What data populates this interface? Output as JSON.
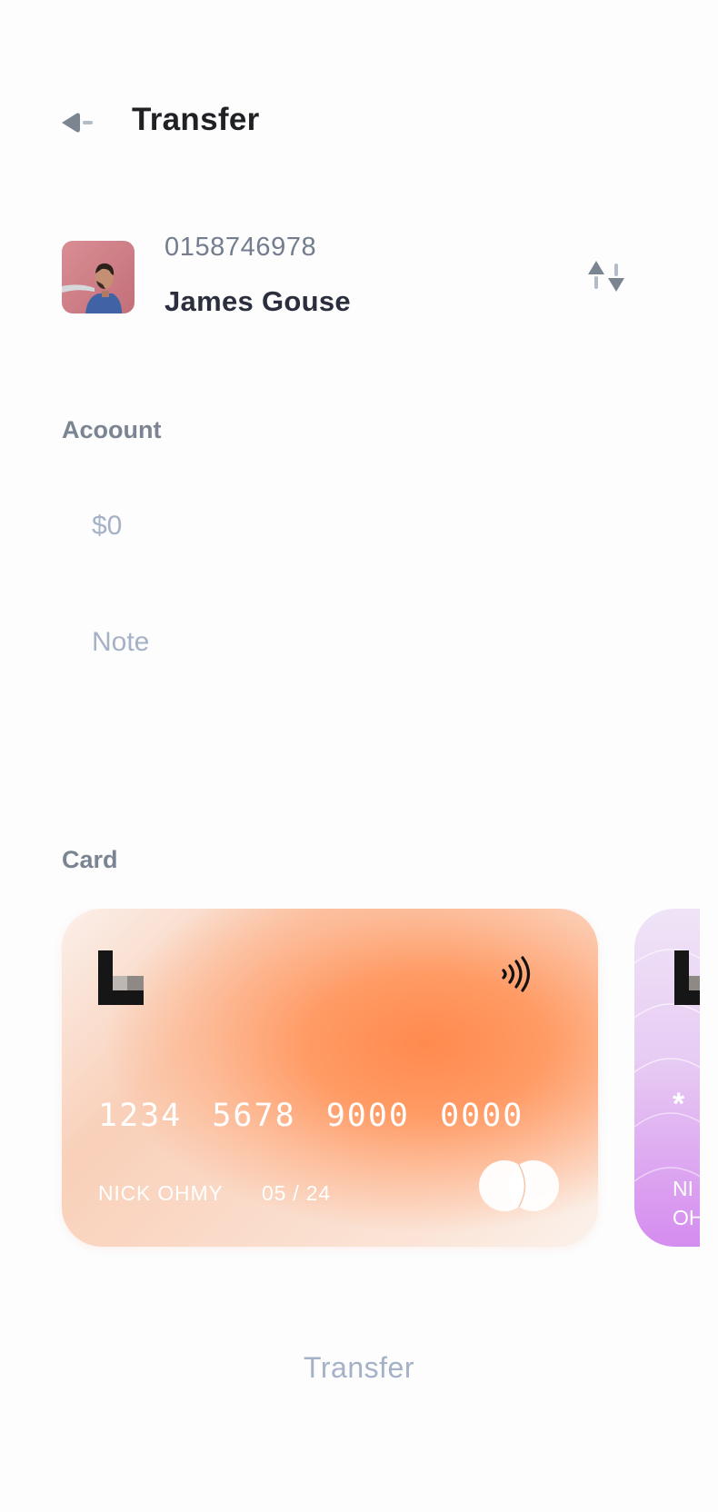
{
  "header": {
    "title": "Transfer",
    "back_icon": "arrow-left-icon"
  },
  "recipient": {
    "number": "0158746978",
    "name": "James Gouse",
    "swap_icon": "swap-vertical-icon"
  },
  "form": {
    "account_label": "Acoount",
    "amount_placeholder": "$0",
    "note_placeholder": "Note",
    "card_label": "Card"
  },
  "cards": [
    {
      "number": "1234 5678 9000 0000",
      "holder": "NICK OHMY",
      "expiry": "05 / 24",
      "accent": "#ff8a4e"
    },
    {
      "number_visible": "*",
      "holder_visible": "NI",
      "holder_visible_2": "OH",
      "accent": "#d58cef"
    }
  ],
  "footer": {
    "transfer_label": "Transfer"
  },
  "colors": {
    "title": "#202124",
    "muted_label": "#7b8592",
    "placeholder": "#a4b1c6",
    "background": "#fdfdfe"
  }
}
